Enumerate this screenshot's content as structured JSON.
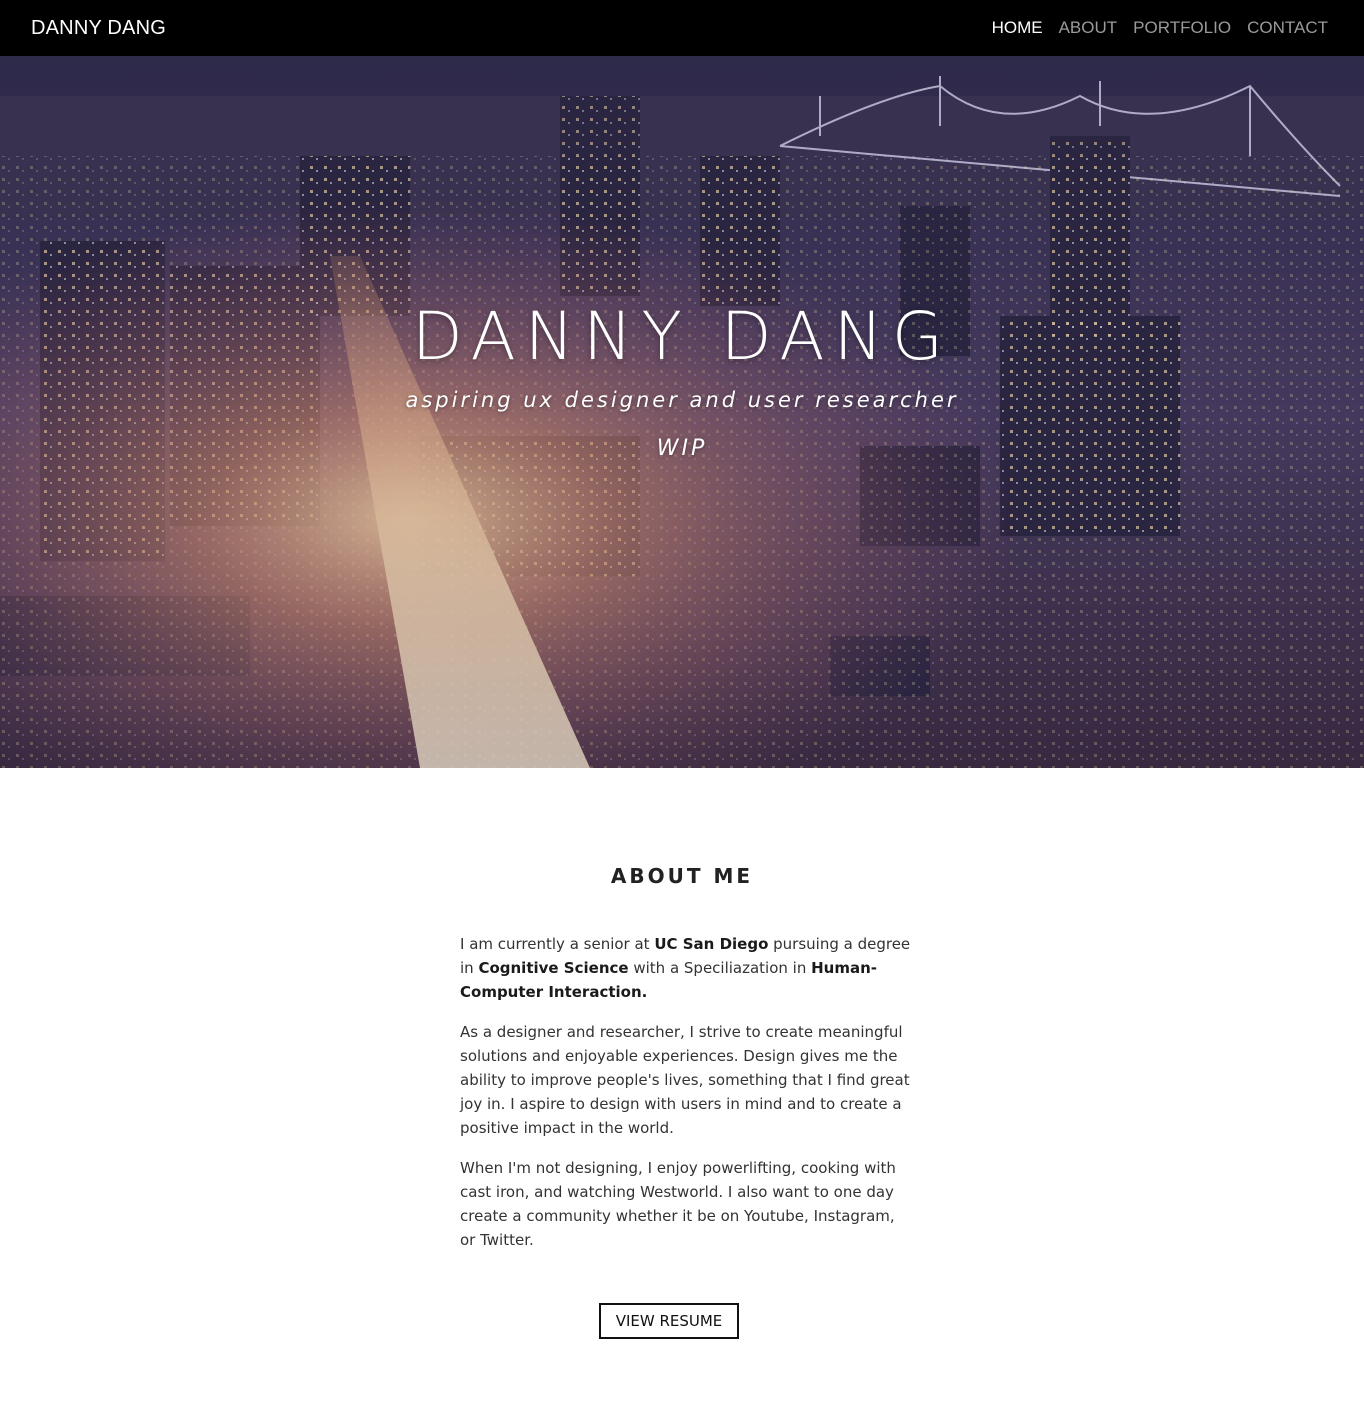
{
  "navbar": {
    "brand": "DANNY DANG",
    "links": [
      {
        "label": "HOME",
        "active": true
      },
      {
        "label": "ABOUT",
        "active": false
      },
      {
        "label": "PORTFOLIO",
        "active": false
      },
      {
        "label": "CONTACT",
        "active": false
      }
    ]
  },
  "hero": {
    "title": "DANNY DANG",
    "subtitle": "aspiring ux designer and user researcher",
    "status": "WIP"
  },
  "about": {
    "heading": "ABOUT ME",
    "p1": {
      "t1": "I am currently a senior at ",
      "b1": "UC San Diego",
      "t2": " pursuing a degree in ",
      "b2": "Cognitive Science",
      "t3": " with a Speciliazation in ",
      "b3": "Human-Computer Interaction."
    },
    "p2": "As a designer and researcher, I strive to create meaningful solutions and enjoyable experiences. Design gives me the ability to improve people's lives, something that I find great joy in. I aspire to design with users in mind and to create a positive impact in the world.",
    "p3": "When I'm not designing, I enjoy powerlifting, cooking with cast iron, and watching Westworld. I also want to one day create a community whether it be on Youtube, Instagram, or Twitter.",
    "button_label": "VIEW RESUME"
  }
}
